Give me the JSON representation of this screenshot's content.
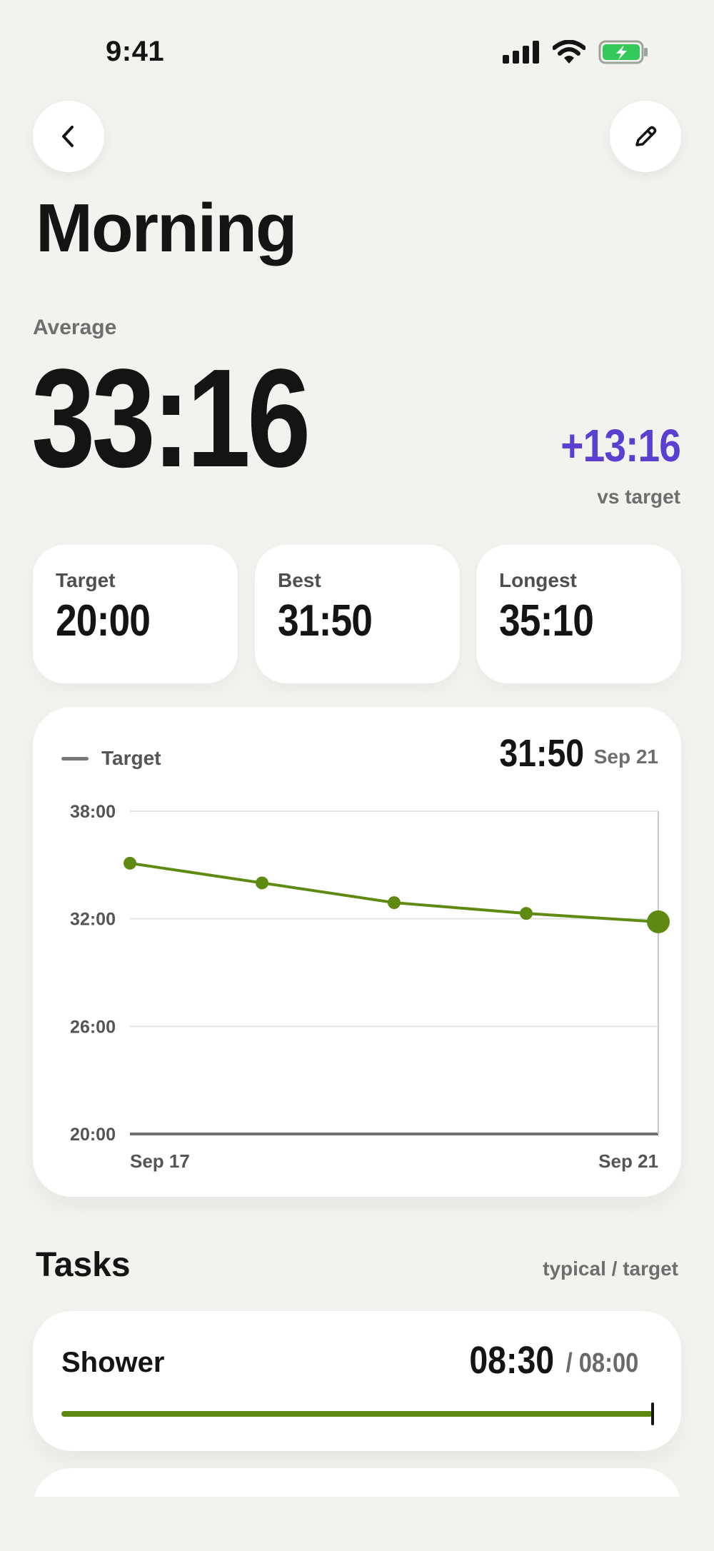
{
  "status_bar": {
    "time": "9:41"
  },
  "header": {
    "title": "Morning"
  },
  "summary": {
    "average_label": "Average",
    "average_value": "33:16",
    "delta_value": "+13:16",
    "delta_label": "vs target",
    "delta_color": "#5b3fd0"
  },
  "stats": [
    {
      "label": "Target",
      "value": "20:00"
    },
    {
      "label": "Best",
      "value": "31:50"
    },
    {
      "label": "Longest",
      "value": "35:10"
    }
  ],
  "chart": {
    "legend_label": "Target",
    "selected_value": "31:50",
    "selected_date": "Sep 21"
  },
  "chart_data": {
    "type": "line",
    "x": [
      "Sep 17",
      "Sep 18",
      "Sep 19",
      "Sep 20",
      "Sep 21"
    ],
    "series": [
      {
        "values": [
          35.1,
          34.0,
          32.9,
          32.3,
          31.83
        ],
        "color": "#5e8a12"
      }
    ],
    "target_line": 20,
    "ylim": [
      20,
      38
    ],
    "yticks": [
      {
        "value": 38,
        "label": "38:00"
      },
      {
        "value": 32,
        "label": "32:00"
      },
      {
        "value": 26,
        "label": "26:00"
      },
      {
        "value": 20,
        "label": "20:00"
      }
    ],
    "xtick_labels": [
      "Sep 17",
      "Sep 21"
    ],
    "selected_index": 4,
    "grid": true
  },
  "tasks": {
    "title": "Tasks",
    "subtitle": "typical / target",
    "items": [
      {
        "name": "Shower",
        "typical": "08:30",
        "target": "/ 08:00",
        "progress": 1.0,
        "bar_color": "#5e8a12"
      }
    ]
  },
  "icons": {
    "back": "chevron-left-icon",
    "edit": "pencil-icon",
    "signal": "cellular-signal-icon",
    "wifi": "wifi-icon",
    "battery": "battery-charging-icon"
  }
}
